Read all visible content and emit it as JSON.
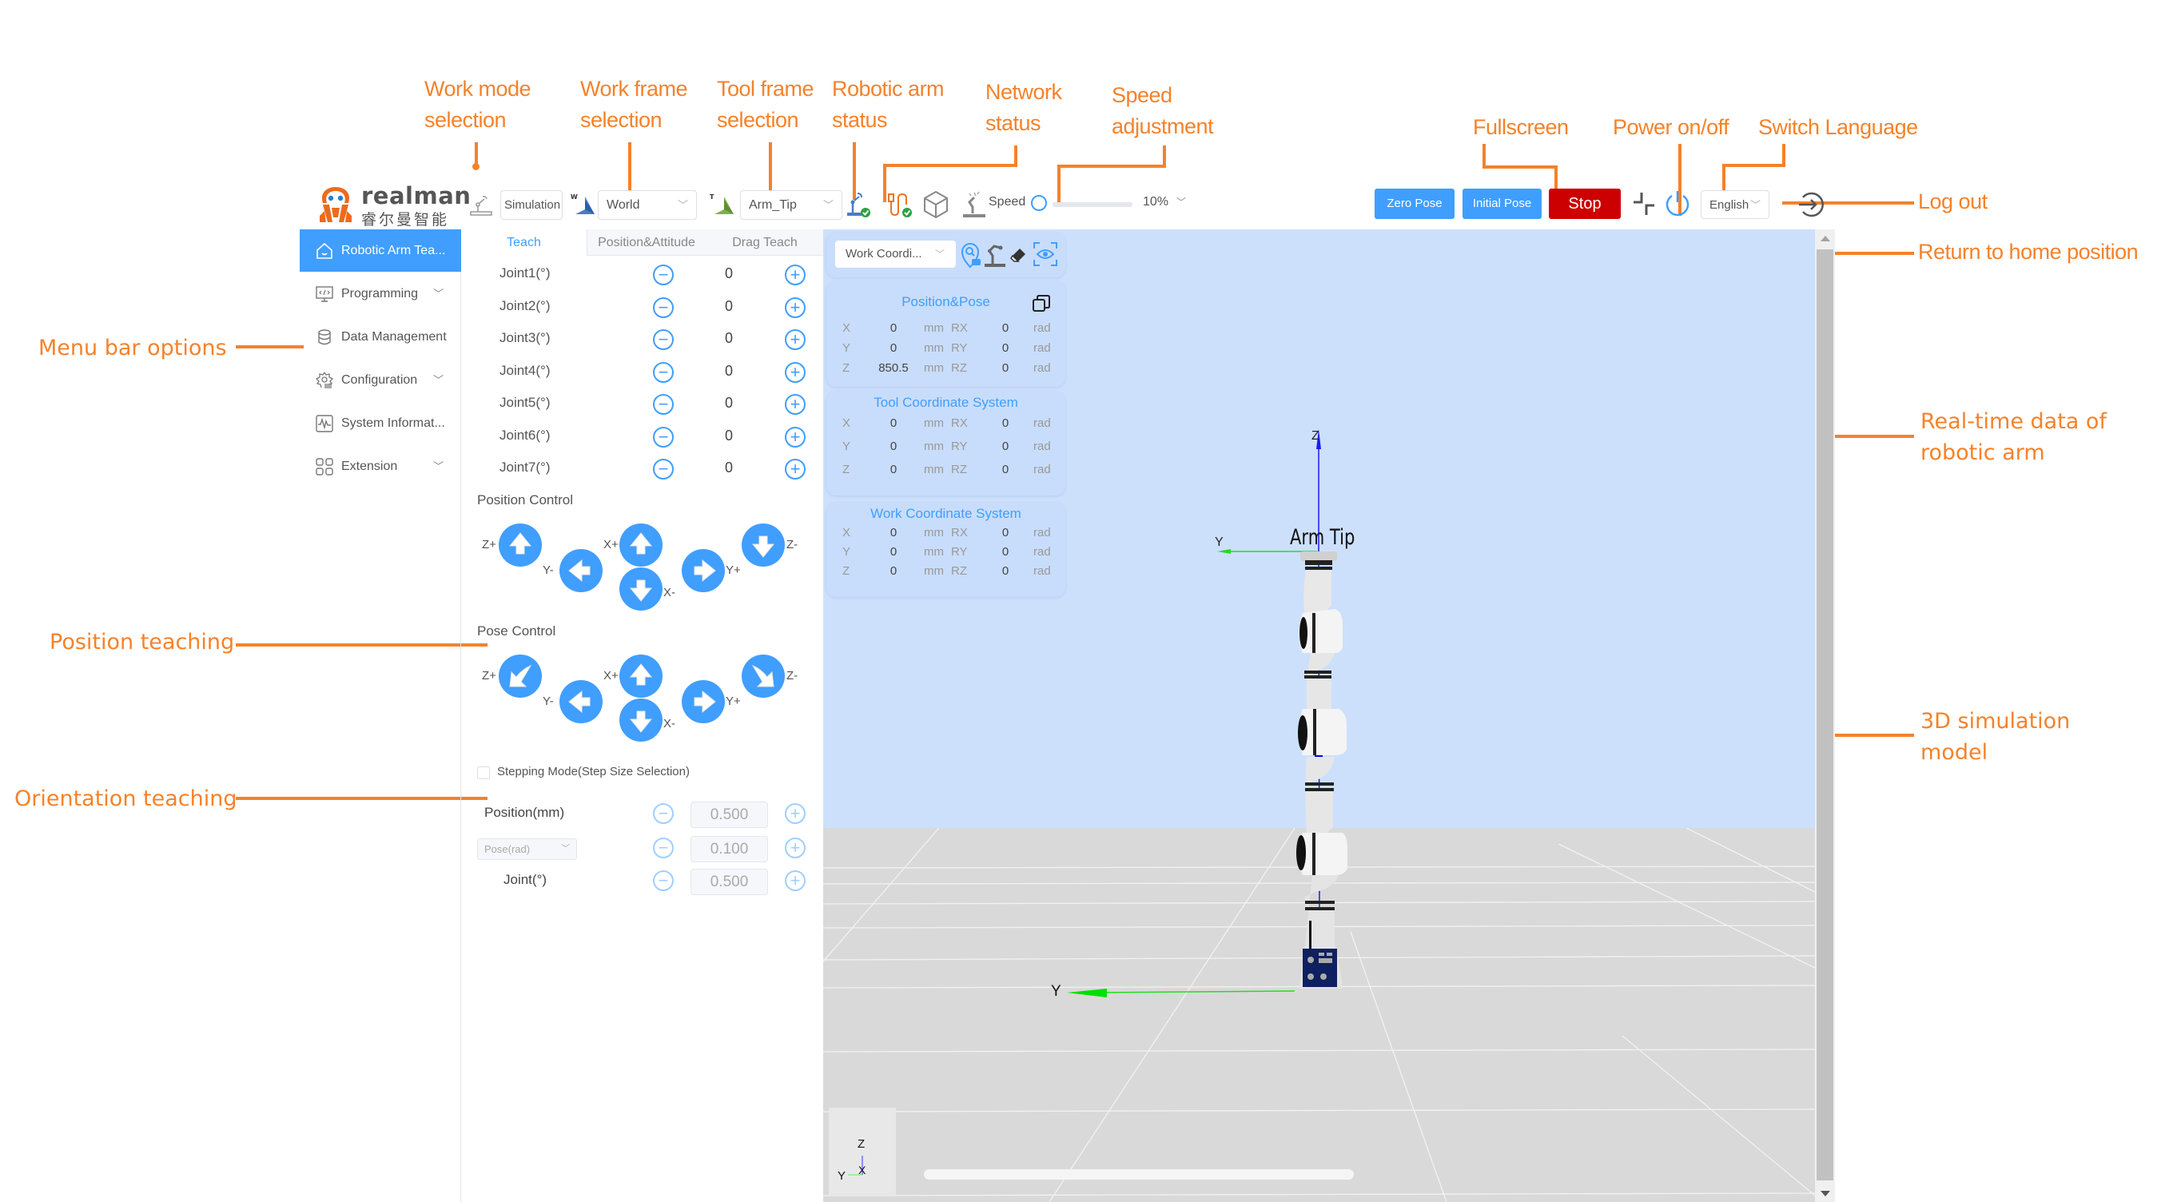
{
  "annotations": {
    "work_mode": [
      "Work mode",
      "selection"
    ],
    "work_frame": [
      "Work frame",
      "selection"
    ],
    "tool_frame": [
      "Tool frame",
      "selection"
    ],
    "arm_status": [
      "Robotic arm",
      "status"
    ],
    "network": [
      "Network",
      "status"
    ],
    "speed": [
      "Speed",
      "adjustment"
    ],
    "fullscreen": "Fullscreen",
    "power": "Power on/off",
    "language": "Switch Language",
    "logout": "Log out",
    "home": "Return to home position",
    "realtime": [
      "Real-time data of",
      "robotic arm"
    ],
    "sim_model": [
      "3D simulation",
      "model"
    ],
    "menu": "Menu bar options",
    "position_teaching": "Position teaching",
    "orientation_teaching": "Orientation teaching"
  },
  "colors": {
    "accent": "#409eff",
    "stop": "#cc0000",
    "annotation": "#f5822a",
    "sky": "#cce0fc",
    "floor": "#d9d9d9"
  },
  "logo": {
    "name": "realman",
    "subtitle": "睿尔曼智能"
  },
  "header": {
    "work_mode": "Simulation",
    "work_frame": "World",
    "tool_frame": "Arm_Tip",
    "speed_label": "Speed",
    "speed_value": "10%",
    "speed_fraction": 0.1,
    "zero_pose": "Zero Pose",
    "initial_pose": "Initial Pose",
    "stop": "Stop",
    "language": "English",
    "icons": [
      "work-mode-icon",
      "world-frame-icon",
      "tool-frame-icon",
      "arm-status-ok-icon",
      "network-status-ok-icon",
      "cube-view-icon",
      "robot-speed-icon",
      "fullscreen-icon",
      "power-icon",
      "logout-icon"
    ]
  },
  "sidebar": {
    "items": [
      {
        "label": "Robotic Arm Tea...",
        "icon": "home-icon",
        "active": true,
        "expandable": false
      },
      {
        "label": "Programming",
        "icon": "code-monitor-icon",
        "active": false,
        "expandable": true
      },
      {
        "label": "Data Management",
        "icon": "database-icon",
        "active": false,
        "expandable": false
      },
      {
        "label": "Configuration",
        "icon": "gear-list-icon",
        "active": false,
        "expandable": true
      },
      {
        "label": "System Informat...",
        "icon": "pulse-icon",
        "active": false,
        "expandable": false
      },
      {
        "label": "Extension",
        "icon": "grid-apps-icon",
        "active": false,
        "expandable": true
      }
    ]
  },
  "teach": {
    "tabs": [
      "Teach",
      "Position&Attitude",
      "Drag Teach"
    ],
    "active_tab": 0,
    "joints": [
      {
        "label": "Joint1(°)",
        "value": "0"
      },
      {
        "label": "Joint2(°)",
        "value": "0"
      },
      {
        "label": "Joint3(°)",
        "value": "0"
      },
      {
        "label": "Joint4(°)",
        "value": "0"
      },
      {
        "label": "Joint5(°)",
        "value": "0"
      },
      {
        "label": "Joint6(°)",
        "value": "0"
      },
      {
        "label": "Joint7(°)",
        "value": "0"
      }
    ],
    "position_control": {
      "title": "Position Control",
      "labels": {
        "zp": "Z+",
        "ym": "Y-",
        "xp": "X+",
        "xm": "X-",
        "yp": "Y+",
        "zm": "Z-"
      }
    },
    "pose_control": {
      "title": "Pose Control",
      "labels": {
        "zp": "Z+",
        "ym": "Y-",
        "xp": "X+",
        "xm": "X-",
        "yp": "Y+",
        "zm": "Z-"
      }
    },
    "stepping": {
      "checkbox_label": "Stepping Mode(Step Size Selection)",
      "checked": false,
      "position_label": "Position(mm)",
      "position_value": "0.500",
      "pose_select": "Pose(rad)",
      "pose_value": "0.100",
      "joint_label": "Joint(°)",
      "joint_value": "0.500"
    }
  },
  "viewport": {
    "coord_select": "Work Coordi...",
    "arm_tip_label": "Arm Tip",
    "axis_labels": {
      "z": "Z",
      "y": "Y",
      "x": "X"
    },
    "cards": [
      {
        "title": "Position&Pose",
        "rows": [
          {
            "axis": "X",
            "value": "0",
            "unit": "mm",
            "raxis": "RX",
            "rvalue": "0",
            "runit": "rad"
          },
          {
            "axis": "Y",
            "value": "0",
            "unit": "mm",
            "raxis": "RY",
            "rvalue": "0",
            "runit": "rad"
          },
          {
            "axis": "Z",
            "value": "850.5",
            "unit": "mm",
            "raxis": "RZ",
            "rvalue": "0",
            "runit": "rad"
          }
        ]
      },
      {
        "title": "Tool Coordinate System",
        "rows": [
          {
            "axis": "X",
            "value": "0",
            "unit": "mm",
            "raxis": "RX",
            "rvalue": "0",
            "runit": "rad"
          },
          {
            "axis": "Y",
            "value": "0",
            "unit": "mm",
            "raxis": "RY",
            "rvalue": "0",
            "runit": "rad"
          },
          {
            "axis": "Z",
            "value": "0",
            "unit": "mm",
            "raxis": "RZ",
            "rvalue": "0",
            "runit": "rad"
          }
        ]
      },
      {
        "title": "Work Coordinate System",
        "rows": [
          {
            "axis": "X",
            "value": "0",
            "unit": "mm",
            "raxis": "RX",
            "rvalue": "0",
            "runit": "rad"
          },
          {
            "axis": "Y",
            "value": "0",
            "unit": "mm",
            "raxis": "RY",
            "rvalue": "0",
            "runit": "rad"
          },
          {
            "axis": "Z",
            "value": "0",
            "unit": "mm",
            "raxis": "RZ",
            "rvalue": "0",
            "runit": "rad"
          }
        ]
      }
    ]
  }
}
